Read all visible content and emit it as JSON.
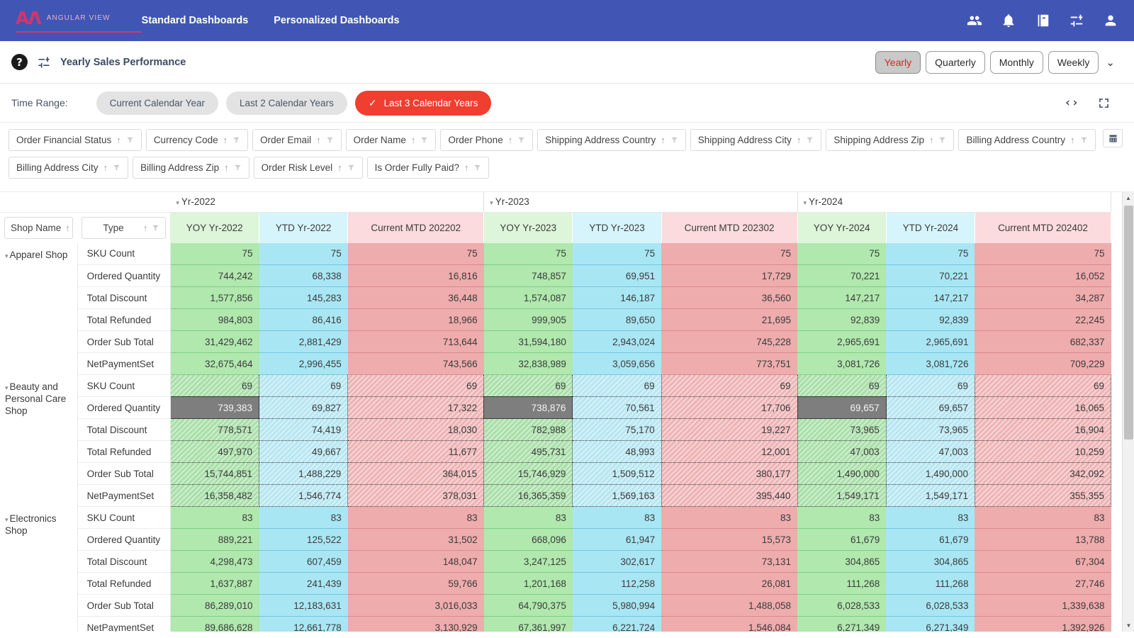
{
  "topnav": {
    "brand_mark": "AΛ",
    "brand_text": "ANGULAR VIEW",
    "links": [
      {
        "label": "Standard Dashboards"
      },
      {
        "label": "Personalized Dashboards"
      }
    ],
    "icons": [
      "people-icon",
      "bell-icon",
      "book-icon",
      "settings-sliders-icon",
      "account-icon"
    ],
    "background": "#4156b4"
  },
  "titlebar": {
    "help_label": "?",
    "settings_icon": "settings-sliders-icon",
    "title": "Yearly Sales Performance",
    "periods": [
      {
        "label": "Yearly",
        "active": true
      },
      {
        "label": "Quarterly",
        "active": false
      },
      {
        "label": "Monthly",
        "active": false
      },
      {
        "label": "Weekly",
        "active": false
      }
    ],
    "more_chevron": "⌄",
    "active_color": "#cc2a20"
  },
  "timerange": {
    "label": "Time Range:",
    "options": [
      {
        "label": "Current Calendar Year",
        "selected": false
      },
      {
        "label": "Last 2 Calendar Years",
        "selected": false
      },
      {
        "label": "Last 3 Calendar Years",
        "selected": true
      }
    ],
    "check_glyph": "✓",
    "selected_color": "#f03e2f",
    "code_icon": "‹›",
    "fullscreen_icon": "fullscreen-icon"
  },
  "filters": {
    "sort_glyph": "↑",
    "export_icon": "xlsx-export-icon",
    "row1": [
      "Order Financial Status",
      "Currency Code",
      "Order Email",
      "Order Name",
      "Order Phone",
      "Shipping Address Country",
      "Shipping Address City",
      "Shipping Address Zip",
      "Billing Address Country"
    ],
    "row2": [
      "Billing Address City",
      "Billing Address Zip",
      "Order Risk Level",
      "Is Order Fully Paid?"
    ]
  },
  "grid": {
    "row_headers": [
      {
        "label": "Shop Name",
        "sort": "↑"
      },
      {
        "label": "Type",
        "sort": "↑"
      }
    ],
    "year_groups": [
      {
        "label": "Yr-2022",
        "columns": [
          "YOY Yr-2022",
          "YTD Yr-2022",
          "Current MTD 202202"
        ]
      },
      {
        "label": "Yr-2023",
        "columns": [
          "YOY Yr-2023",
          "YTD Yr-2023",
          "Current MTD 202302"
        ]
      },
      {
        "label": "Yr-2024",
        "columns": [
          "YOY Yr-2024",
          "YTD Yr-2024",
          "Current MTD 202402"
        ]
      }
    ],
    "measures": [
      "SKU Count",
      "Ordered Quantity",
      "Total Discount",
      "Total Refunded",
      "Order Sub Total",
      "NetPaymentSet"
    ],
    "colors": {
      "green": "#b0e8ae",
      "cyan": "#a9e6f4",
      "pink": "#eeacad",
      "header_green": "#ddf5d8",
      "header_cyan": "#d6f4fb",
      "header_pink": "#fbdbdd"
    },
    "shops": [
      {
        "name": "Apparel Shop",
        "selected": false,
        "rows": [
          {
            "measure": "SKU Count",
            "values": [
              "75",
              "75",
              "75",
              "75",
              "75",
              "75",
              "75",
              "75",
              "75"
            ]
          },
          {
            "measure": "Ordered Quantity",
            "values": [
              "744,242",
              "68,338",
              "16,816",
              "748,857",
              "69,951",
              "17,729",
              "70,221",
              "70,221",
              "16,052"
            ]
          },
          {
            "measure": "Total Discount",
            "values": [
              "1,577,856",
              "145,283",
              "36,448",
              "1,574,087",
              "146,187",
              "36,560",
              "147,217",
              "147,217",
              "34,287"
            ]
          },
          {
            "measure": "Total Refunded",
            "values": [
              "984,803",
              "86,416",
              "18,966",
              "999,905",
              "89,650",
              "21,695",
              "92,839",
              "92,839",
              "22,245"
            ]
          },
          {
            "measure": "Order Sub Total",
            "values": [
              "31,429,462",
              "2,881,429",
              "713,644",
              "31,594,180",
              "2,943,024",
              "745,228",
              "2,965,691",
              "2,965,691",
              "682,337"
            ]
          },
          {
            "measure": "NetPaymentSet",
            "values": [
              "32,675,464",
              "2,996,455",
              "743,566",
              "32,838,989",
              "3,059,656",
              "773,751",
              "3,081,726",
              "3,081,726",
              "709,229"
            ]
          }
        ]
      },
      {
        "name": "Beauty and Personal Care Shop",
        "selected": true,
        "focused_measure": "Ordered Quantity",
        "focused_columns": [
          0,
          3,
          6
        ],
        "rows": [
          {
            "measure": "SKU Count",
            "values": [
              "69",
              "69",
              "69",
              "69",
              "69",
              "69",
              "69",
              "69",
              "69"
            ]
          },
          {
            "measure": "Ordered Quantity",
            "values": [
              "739,383",
              "69,827",
              "17,322",
              "738,876",
              "70,561",
              "17,706",
              "69,657",
              "69,657",
              "16,065"
            ]
          },
          {
            "measure": "Total Discount",
            "values": [
              "778,571",
              "74,419",
              "18,030",
              "782,988",
              "75,170",
              "19,227",
              "73,965",
              "73,965",
              "16,904"
            ]
          },
          {
            "measure": "Total Refunded",
            "values": [
              "497,970",
              "49,667",
              "11,677",
              "495,731",
              "48,993",
              "12,001",
              "47,003",
              "47,003",
              "10,259"
            ]
          },
          {
            "measure": "Order Sub Total",
            "values": [
              "15,744,851",
              "1,488,229",
              "364,015",
              "15,746,929",
              "1,509,512",
              "380,177",
              "1,490,000",
              "1,490,000",
              "342,092"
            ]
          },
          {
            "measure": "NetPaymentSet",
            "values": [
              "16,358,482",
              "1,546,774",
              "378,031",
              "16,365,359",
              "1,569,163",
              "395,440",
              "1,549,171",
              "1,549,171",
              "355,355"
            ]
          }
        ]
      },
      {
        "name": "Electronics Shop",
        "selected": false,
        "rows": [
          {
            "measure": "SKU Count",
            "values": [
              "83",
              "83",
              "83",
              "83",
              "83",
              "83",
              "83",
              "83",
              "83"
            ]
          },
          {
            "measure": "Ordered Quantity",
            "values": [
              "889,221",
              "125,522",
              "31,502",
              "668,096",
              "61,947",
              "15,573",
              "61,679",
              "61,679",
              "13,788"
            ]
          },
          {
            "measure": "Total Discount",
            "values": [
              "4,298,473",
              "607,459",
              "148,047",
              "3,247,125",
              "302,617",
              "73,131",
              "304,865",
              "304,865",
              "67,304"
            ]
          },
          {
            "measure": "Total Refunded",
            "values": [
              "1,637,887",
              "241,439",
              "59,766",
              "1,201,168",
              "112,258",
              "26,081",
              "111,268",
              "111,268",
              "27,746"
            ]
          },
          {
            "measure": "Order Sub Total",
            "values": [
              "86,289,010",
              "12,183,631",
              "3,016,033",
              "64,790,375",
              "5,980,994",
              "1,488,058",
              "6,028,533",
              "6,028,533",
              "1,339,638"
            ]
          },
          {
            "measure": "NetPaymentSet",
            "values": [
              "89,686,628",
              "12,661,778",
              "3,130,929",
              "67,361,997",
              "6,221,724",
              "1,546,084",
              "6,271,349",
              "6,271,349",
              "1,392,926"
            ]
          }
        ]
      }
    ]
  },
  "scrollbar": {
    "up": "▲",
    "down": "▼"
  }
}
